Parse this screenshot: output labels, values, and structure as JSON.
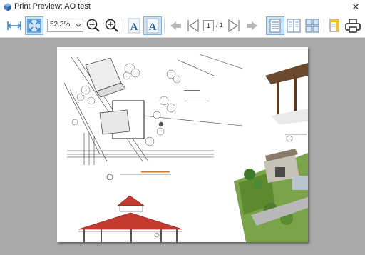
{
  "window": {
    "title": "Print Preview: AO test",
    "close_label": "✕"
  },
  "toolbar": {
    "fit_width_icon": "fit-width-icon",
    "fit_page_icon": "fit-page-icon",
    "zoom_value": "52.3%",
    "zoom_out_icon": "zoom-out-icon",
    "zoom_in_icon": "zoom-in-icon",
    "font_icon": "font-icon",
    "font_larger_icon": "font-larger-icon",
    "first_page_icon": "first-page-icon",
    "previous_page_icon": "previous-page-icon",
    "current_page": "1",
    "page_total": "/ 1",
    "next_page_icon": "next-page-icon",
    "last_page_icon": "last-page-icon",
    "single_page_icon": "single-page-icon",
    "two_pages_icon": "two-pages-icon",
    "multi_page_icon": "multi-page-icon",
    "page_setup_icon": "page-setup-icon",
    "print_icon": "print-icon"
  },
  "colors": {
    "accent_active": "#cde4f7",
    "viewport_background": "#a9a9a9",
    "toolbar_icon_blue": "#2f7fcf"
  }
}
